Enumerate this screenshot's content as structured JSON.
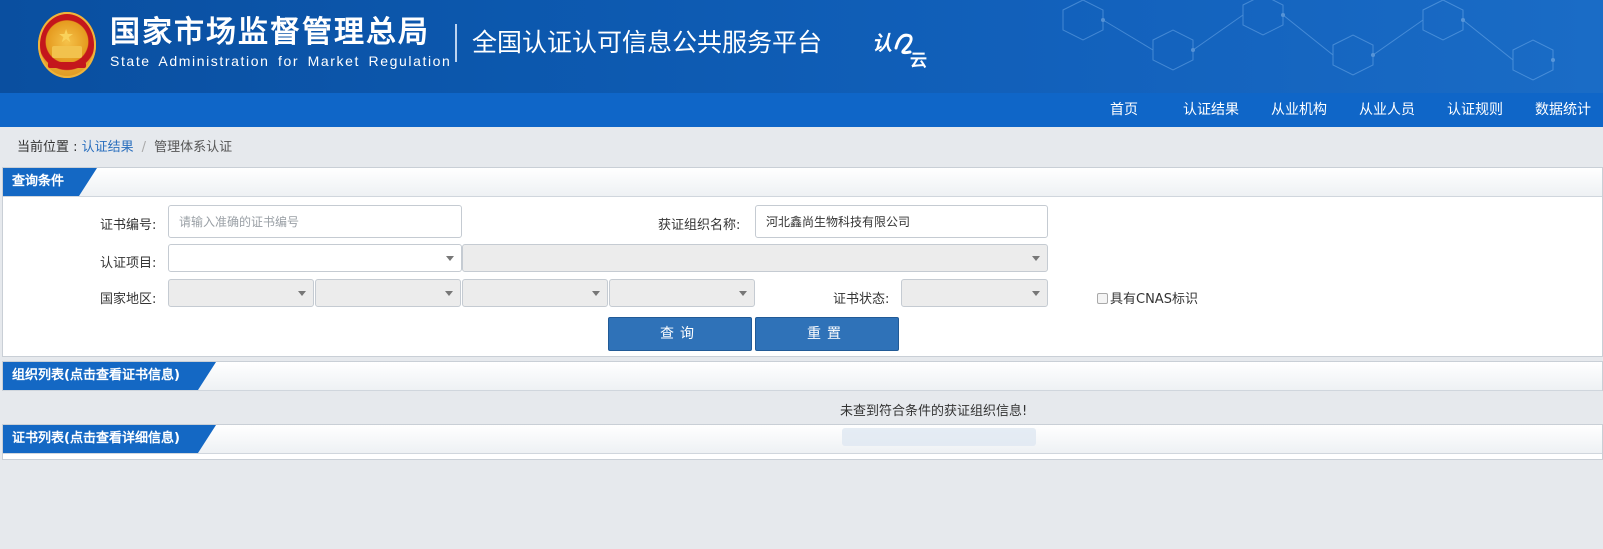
{
  "header": {
    "agency_cn": "国家市场监督管理总局",
    "agency_en": "State Administration  for  Market Regulation",
    "platform_title": "全国认证认可信息公共服务平台",
    "logo_text": "认证云",
    "bg_color": "#0d5ab1"
  },
  "nav": {
    "items": [
      "首页",
      "认证结果",
      "从业机构",
      "从业人员",
      "认证规则",
      "数据统计"
    ],
    "bg_color": "#0f66c8"
  },
  "breadcrumb": {
    "prefix": "当前位置 : ",
    "link": "认证结果",
    "separator": "/",
    "current": "管理体系认证"
  },
  "query_panel": {
    "title": "查询条件",
    "cert_no_label": "证书编号:",
    "cert_no_placeholder": "请输入准确的证书编号",
    "cert_no_value": "",
    "org_name_label": "获证组织名称:",
    "org_name_value": "河北鑫尚生物科技有限公司",
    "cert_project_label": "认证项目:",
    "country_label": "国家地区:",
    "cert_status_label": "证书状态:",
    "cnas_label": "具有CNAS标识",
    "cnas_checked": false,
    "search_button": "查询",
    "reset_button": "重置"
  },
  "org_list": {
    "title": "组织列表(点击查看证书信息)",
    "empty_message": "未查到符合条件的获证组织信息!"
  },
  "cert_list": {
    "title": "证书列表(点击查看详细信息)"
  },
  "theme": {
    "accent": "#1468c4",
    "button": "#2f72b8"
  }
}
